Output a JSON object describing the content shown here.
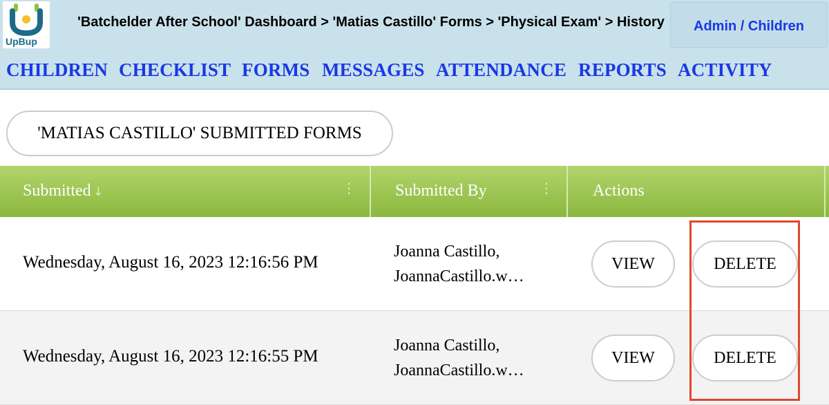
{
  "header": {
    "logo_text": "UpBup",
    "breadcrumb": "'Batchelder After School' Dashboard > 'Matias Castillo' Forms > 'Physical Exam' > History",
    "admin_link": "Admin / Children"
  },
  "nav": {
    "items": [
      "CHILDREN",
      "CHECKLIST",
      "FORMS",
      "MESSAGES",
      "ATTENDANCE",
      "REPORTS",
      "ACTIVITY"
    ]
  },
  "page": {
    "title": "'MATIAS CASTILLO' SUBMITTED FORMS"
  },
  "table": {
    "columns": [
      "Submitted",
      "Submitted By",
      "Actions"
    ],
    "sort_indicator": "↓",
    "rows": [
      {
        "submitted": "Wednesday, August 16, 2023 12:16:56 PM",
        "submitted_by_name": "Joanna Castillo,",
        "submitted_by_email": "JoannaCastillo.w…",
        "view_label": "VIEW",
        "delete_label": "DELETE"
      },
      {
        "submitted": "Wednesday, August 16, 2023 12:16:55 PM",
        "submitted_by_name": "Joanna Castillo,",
        "submitted_by_email": "JoannaCastillo.w…",
        "view_label": "VIEW",
        "delete_label": "DELETE"
      }
    ]
  },
  "colors": {
    "nav_bg": "#c9e1ea",
    "link_blue": "#1838e6",
    "header_green": "#9cc653",
    "highlight_red": "#e0462f",
    "alt_row": "#f3f3f3"
  }
}
